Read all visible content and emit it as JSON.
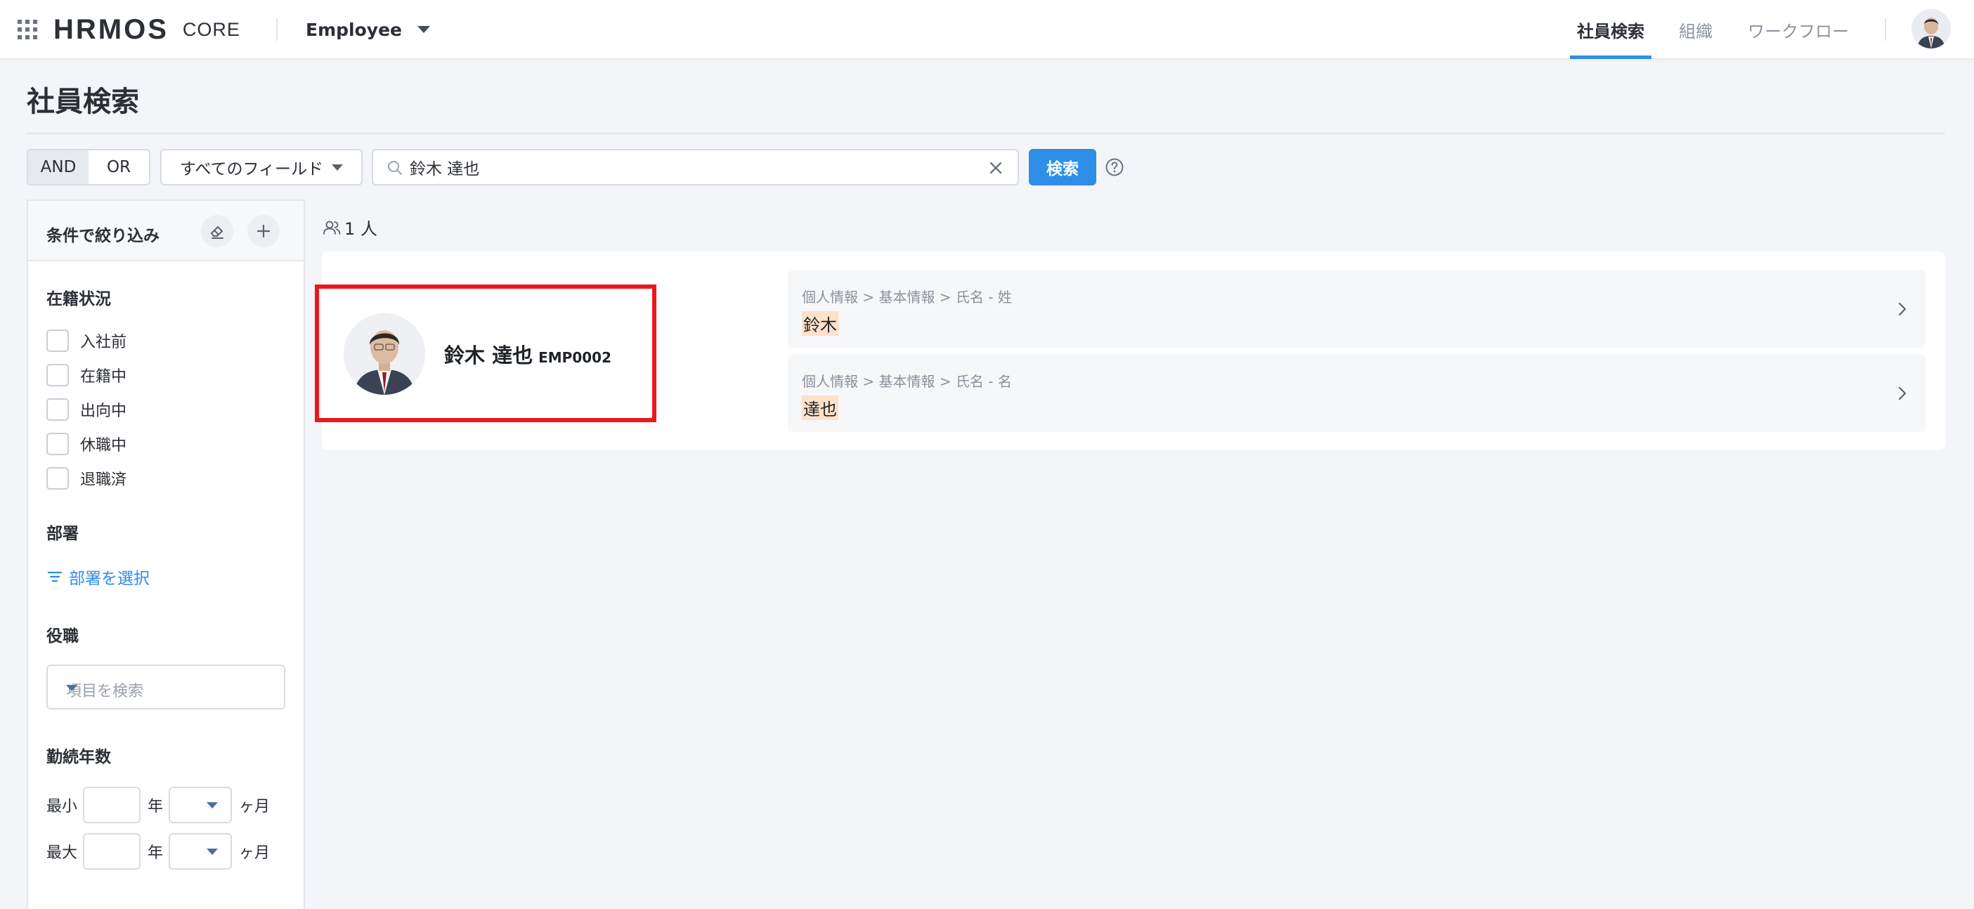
{
  "header": {
    "logo": "HRMOS",
    "logo_sub": "CORE",
    "app_switch_label": "Employee",
    "nav": [
      {
        "label": "社員検索",
        "active": true
      },
      {
        "label": "組織",
        "active": false
      },
      {
        "label": "ワークフロー",
        "active": false
      }
    ],
    "accent_color": "#2f8ee8"
  },
  "page": {
    "title": "社員検索"
  },
  "search": {
    "logic_and": "AND",
    "logic_or": "OR",
    "logic_selected": "AND",
    "field_select_value": "すべてのフィールド",
    "query": "鈴木 達也",
    "button_label": "検索"
  },
  "sidebar": {
    "title": "条件で絞り込み",
    "status": {
      "heading": "在籍状況",
      "options": [
        {
          "label": "入社前",
          "checked": false
        },
        {
          "label": "在籍中",
          "checked": false
        },
        {
          "label": "出向中",
          "checked": false
        },
        {
          "label": "休職中",
          "checked": false
        },
        {
          "label": "退職済",
          "checked": false
        }
      ]
    },
    "department": {
      "heading": "部署",
      "select_link": "部署を選択"
    },
    "position": {
      "heading": "役職",
      "placeholder": "項目を検索"
    },
    "tenure": {
      "heading": "勤続年数",
      "min_label": "最小",
      "max_label": "最大",
      "year_unit": "年",
      "month_unit": "ヶ月"
    }
  },
  "results": {
    "count_text": "1 人",
    "items": [
      {
        "name": "鈴木 達也",
        "employee_id": "EMP0002",
        "matches": [
          {
            "path": "個人情報 > 基本情報 > 氏名 - 姓",
            "value": "鈴木"
          },
          {
            "path": "個人情報 > 基本情報 > 氏名 - 名",
            "value": "達也"
          }
        ]
      }
    ],
    "highlight_color": "#fde1c8",
    "selection_border_color": "#e8191c"
  }
}
